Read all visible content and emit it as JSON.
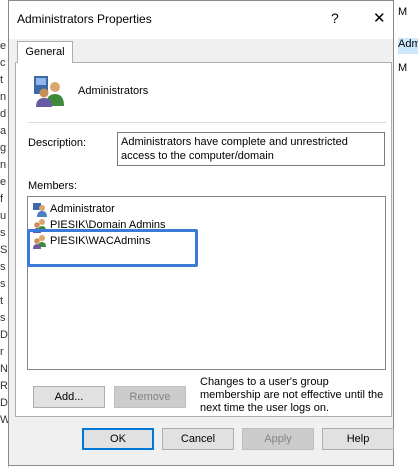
{
  "background": {
    "left_fragments": [
      "e",
      "c",
      "t",
      "n",
      "d",
      "a",
      "g",
      "n",
      "e",
      "f",
      "u",
      "s",
      "S",
      "s",
      "s",
      "t",
      "s",
      "D",
      "r",
      "N",
      "R",
      "D",
      "W"
    ],
    "right_items": [
      {
        "label": "M",
        "selected": false
      },
      {
        "label": "Admin",
        "selected": true
      },
      {
        "label": "M",
        "selected": false
      }
    ]
  },
  "window": {
    "title": "Administrators Properties",
    "help_glyph": "?",
    "close_glyph": "✕"
  },
  "tabs": [
    {
      "label": "General",
      "selected": true
    }
  ],
  "group": {
    "name": "Administrators",
    "icon": "group-icon"
  },
  "description": {
    "label": "Description:",
    "value": "Administrators have complete and unrestricted access to the computer/domain"
  },
  "members": {
    "label": "Members:",
    "items": [
      {
        "name": "Administrator",
        "icon": "user-icon"
      },
      {
        "name": "PIESIK\\Domain Admins",
        "icon": "group-icon"
      },
      {
        "name": "PIESIK\\WACAdmins",
        "icon": "group-icon"
      }
    ]
  },
  "buttons": {
    "add": "Add...",
    "remove": "Remove",
    "ok": "OK",
    "cancel": "Cancel",
    "apply": "Apply",
    "help": "Help"
  },
  "note": "Changes to a user's group membership are not effective until the next time the user logs on.",
  "colors": {
    "highlight": "#3d7ad8",
    "dialog_bg": "#f0f0f0",
    "selection": "#cce8ff"
  }
}
